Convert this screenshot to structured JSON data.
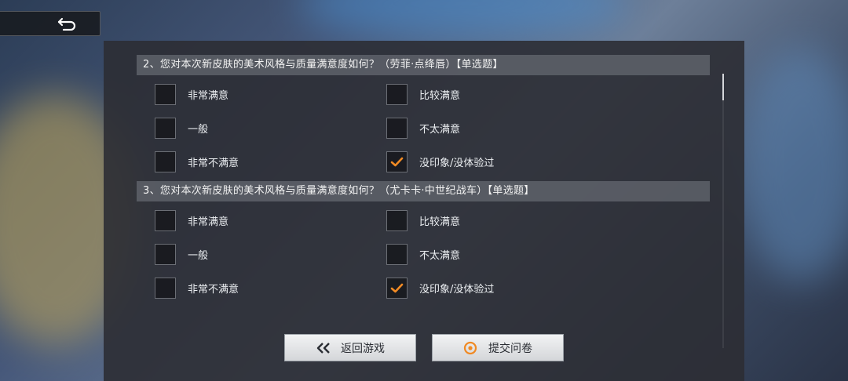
{
  "back_button": {
    "icon": "return-arrow-icon"
  },
  "questions": [
    {
      "title": "2、您对本次新皮肤的美术风格与质量满意度如何？（劳菲·点绛唇）【单选题】",
      "options": [
        {
          "label": "非常满意",
          "checked": false
        },
        {
          "label": "比较满意",
          "checked": false
        },
        {
          "label": "一般",
          "checked": false
        },
        {
          "label": "不太满意",
          "checked": false
        },
        {
          "label": "非常不满意",
          "checked": false
        },
        {
          "label": "没印象/没体验过",
          "checked": true
        }
      ]
    },
    {
      "title": "3、您对本次新皮肤的美术风格与质量满意度如何？（尤卡卡·中世纪战车）【单选题】",
      "options": [
        {
          "label": "非常满意",
          "checked": false
        },
        {
          "label": "比较满意",
          "checked": false
        },
        {
          "label": "一般",
          "checked": false
        },
        {
          "label": "不太满意",
          "checked": false
        },
        {
          "label": "非常不满意",
          "checked": false
        },
        {
          "label": "没印象/没体验过",
          "checked": true
        }
      ]
    }
  ],
  "footer": {
    "back_game_label": "返回游戏",
    "back_game_icon": "double-chevron-left-icon",
    "submit_label": "提交问卷",
    "submit_icon": "orange-target-icon"
  },
  "colors": {
    "accent": "#f08a24",
    "panel": "#2c2e34",
    "title_bar": "#64686f"
  }
}
